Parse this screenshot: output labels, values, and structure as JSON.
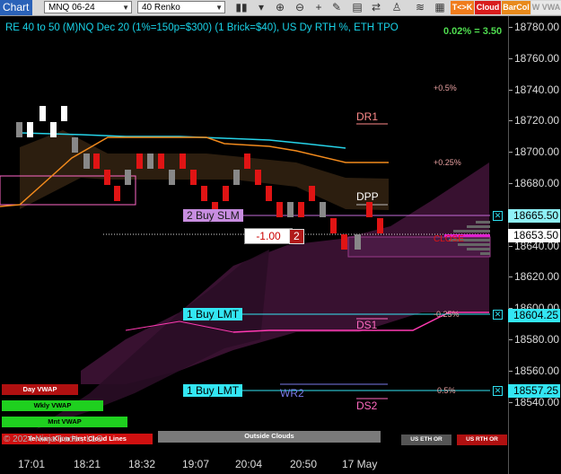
{
  "toolbar": {
    "chart_tab": "Chart",
    "instrument": "MNQ 06-24",
    "bar_type": "40 Renko",
    "buttons": [
      {
        "label": "T<>K",
        "bg": "#f07c1c",
        "fg": "#fff"
      },
      {
        "label": "Cloud",
        "bg": "#d81c1c",
        "fg": "#fff"
      },
      {
        "label": "BarCol",
        "bg": "#e88a1c",
        "fg": "#fff"
      },
      {
        "label": "W VWA",
        "bg": "#e8e8e8",
        "fg": "#999"
      }
    ]
  },
  "chart_title": "RE 40 to 50 (M)NQ Dec 20 (1%=150p=$300) (1 Brick=$40), US Dy RTH %, ETH TPO",
  "pnl": "0.02% = 3.50",
  "y_axis": {
    "ticks": [
      "18780.00",
      "18760.00",
      "18740.00",
      "18720.00",
      "18700.00",
      "18680.00",
      "18660.00",
      "18640.00",
      "18620.00",
      "18600.00",
      "18580.00",
      "18560.00",
      "18540.00"
    ],
    "flags": [
      {
        "label": "18665.50",
        "bg": "#8ff1f7"
      },
      {
        "label": "18653.50",
        "bg": "#ffffff"
      },
      {
        "label": "18604.25",
        "bg": "#33e6f3"
      },
      {
        "label": "18557.25",
        "bg": "#33e6f3"
      }
    ]
  },
  "x_axis": [
    "17:01",
    "18:21",
    "18:32",
    "19:07",
    "20:04",
    "20:50",
    "17 May"
  ],
  "pivots": {
    "dr1": "DR1",
    "dpp": "DPP",
    "ds1": "DS1",
    "ds2": "DS2",
    "wr2": "WR2"
  },
  "percent_labels": {
    "p05": "+0.5%",
    "p025": "+0.25%",
    "m025": "-0.25%",
    "m05": "0.5%"
  },
  "orders": {
    "buy_slm": "2 Buy SLM",
    "buy_lmt1": "1 Buy LMT",
    "buy_lmt2": "1 Buy LMT",
    "position_pnl": "-1.00",
    "position_qty": "2"
  },
  "close_label": "CLOSE",
  "vwap_buttons": {
    "day": "Day VWAP",
    "wkly": "Wkly VWAP",
    "mnt": "Mnt VWAP",
    "tenkan": "Tenkan Kijun First Cloud Lines",
    "outside": "Outside Clouds",
    "us_eth_or": "US ETH OR",
    "us_rth_or": "US RTH OR"
  },
  "copyright": "© 2024 NinjaTrader, LLC",
  "colors": {
    "accent_cyan": "#19d3e8",
    "bull": "#ffffff",
    "bear": "#e01414",
    "cloud_bull": "#3a2a10",
    "cloud_bear": "#3a1230"
  }
}
